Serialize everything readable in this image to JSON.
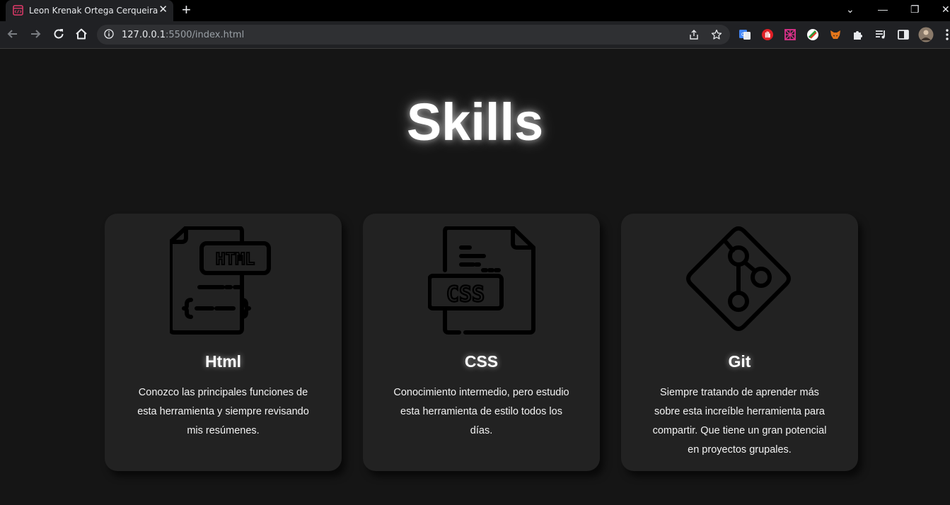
{
  "browser": {
    "tab_title": "Leon Krenak Ortega Cerqueira",
    "tab_close": "✕",
    "new_tab": "+",
    "url_host": "127.0.0.1",
    "url_path": ":5500/index.html",
    "window_controls": {
      "chevron": "⌄",
      "minimize": "—",
      "restore": "❐",
      "close": "✕"
    }
  },
  "page": {
    "title": "Skills"
  },
  "skills": [
    {
      "name": "Html",
      "icon": "html-file-icon",
      "icon_label": "HTML",
      "icon_code": "{— — }",
      "description": "Conozco las principales funciones de esta herramienta y siempre revisando mis resúmenes."
    },
    {
      "name": "CSS",
      "icon": "css-file-icon",
      "icon_label": "CSS",
      "description": "Conocimiento intermedio, pero estudio esta herramienta de estilo todos los días."
    },
    {
      "name": "Git",
      "icon": "git-icon",
      "description": "Siempre tratando de aprender más sobre esta increíble herramienta para compartir. Que tiene un gran potencial en proyectos grupales."
    }
  ],
  "colors": {
    "page_bg": "#151515",
    "card_bg": "#222222",
    "icon_stroke": "#000000",
    "text": "#ffffff"
  }
}
